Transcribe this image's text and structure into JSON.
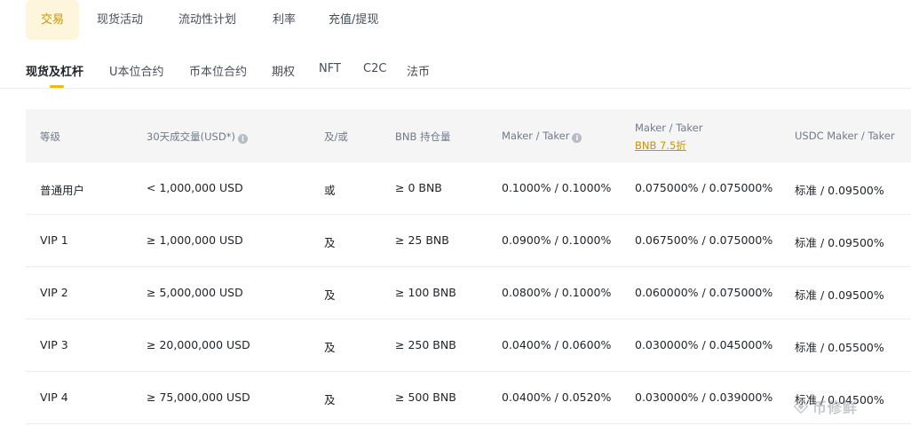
{
  "top_tabs": [
    "交易",
    "现货活动",
    "流动性计划",
    "利率",
    "充值/提现"
  ],
  "sub_tabs": [
    "现货及杠杆",
    "U本位合约",
    "币本位合约",
    "期权",
    "NFT",
    "C2C",
    "法币"
  ],
  "table": {
    "headers": {
      "level": "等级",
      "volume": "30天成交量(USD*)",
      "andor": "及/或",
      "bnb_holding": "BNB 持仓量",
      "maker_taker": "Maker / Taker",
      "maker_taker_bnb": "Maker / Taker",
      "maker_taker_bnb_sub": "BNB 7.5折",
      "usdc_maker_taker": "USDC Maker / Taker"
    },
    "rows": [
      {
        "level": "普通用户",
        "volume": "< 1,000,000 USD",
        "andor": "或",
        "bnb": "≥ 0 BNB",
        "mt": "0.1000% / 0.1000%",
        "mt_bnb": "0.075000% / 0.075000%",
        "usdc": "标准 / 0.09500%"
      },
      {
        "level": "VIP 1",
        "volume": "≥ 1,000,000 USD",
        "andor": "及",
        "bnb": "≥ 25 BNB",
        "mt": "0.0900% / 0.1000%",
        "mt_bnb": "0.067500% / 0.075000%",
        "usdc": "标准 / 0.09500%"
      },
      {
        "level": "VIP 2",
        "volume": "≥ 5,000,000 USD",
        "andor": "及",
        "bnb": "≥ 100 BNB",
        "mt": "0.0800% / 0.1000%",
        "mt_bnb": "0.060000% / 0.075000%",
        "usdc": "标准 / 0.09500%"
      },
      {
        "level": "VIP 3",
        "volume": "≥ 20,000,000 USD",
        "andor": "及",
        "bnb": "≥ 250 BNB",
        "mt": "0.0400% / 0.0600%",
        "mt_bnb": "0.030000% / 0.045000%",
        "usdc": "标准 / 0.05500%"
      },
      {
        "level": "VIP 4",
        "volume": "≥ 75,000,000 USD",
        "andor": "及",
        "bnb": "≥ 500 BNB",
        "mt": "0.0400% / 0.0520%",
        "mt_bnb": "0.030000% / 0.039000%",
        "usdc": "标准 / 0.04500%"
      }
    ]
  },
  "watermark": {
    "text": "币修鲜",
    "icon": "watermark-logo-icon"
  },
  "colors": {
    "accent": "#f0b90b",
    "accent_text": "#c99400",
    "active_tab_bg": "#fdf6dc",
    "header_bg": "#f5f5f5"
  }
}
